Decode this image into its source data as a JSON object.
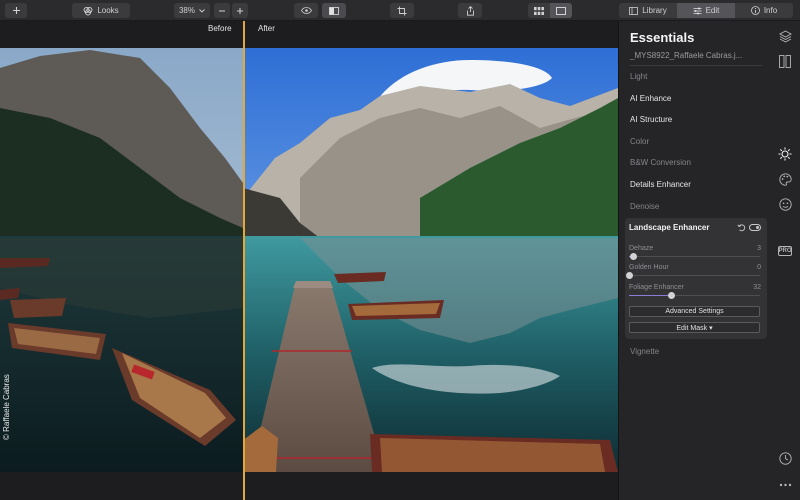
{
  "toolbar": {
    "looks_label": "Looks",
    "zoom_value": "38%",
    "tabs": [
      {
        "label": "Library",
        "icon": "library-icon"
      },
      {
        "label": "Edit",
        "icon": "sliders-icon"
      },
      {
        "label": "Info",
        "icon": "info-icon"
      }
    ]
  },
  "canvas": {
    "before_label": "Before",
    "after_label": "After",
    "credit": "© Raffaele Cabras"
  },
  "panel": {
    "title": "Essentials",
    "filename": "_MYS8922_Raffaele Cabras.j...",
    "tools": [
      "Light",
      "AI Enhance",
      "AI Structure",
      "Color",
      "B&W Conversion",
      "Details Enhancer",
      "Denoise"
    ],
    "after_card_tool": "Vignette",
    "landscape_enhancer": {
      "title": "Landscape Enhancer",
      "sliders": [
        {
          "label": "Dehaze",
          "value": 3
        },
        {
          "label": "Golden Hour",
          "value": 0
        },
        {
          "label": "Foliage Enhancer",
          "value": 32
        }
      ],
      "advanced_settings_label": "Advanced Settings",
      "edit_mask_label": "Edit Mask ▾"
    }
  },
  "rail": {
    "pro_label": "PRO",
    "icons": [
      "layers-icon",
      "compare-icon",
      "sun-icon",
      "palette-icon",
      "face-icon",
      "pro-icon",
      "history-icon",
      "more-icon"
    ]
  },
  "colors": {
    "accent_split": "#e2a83a",
    "slider_fill": "#8a7dd6"
  }
}
